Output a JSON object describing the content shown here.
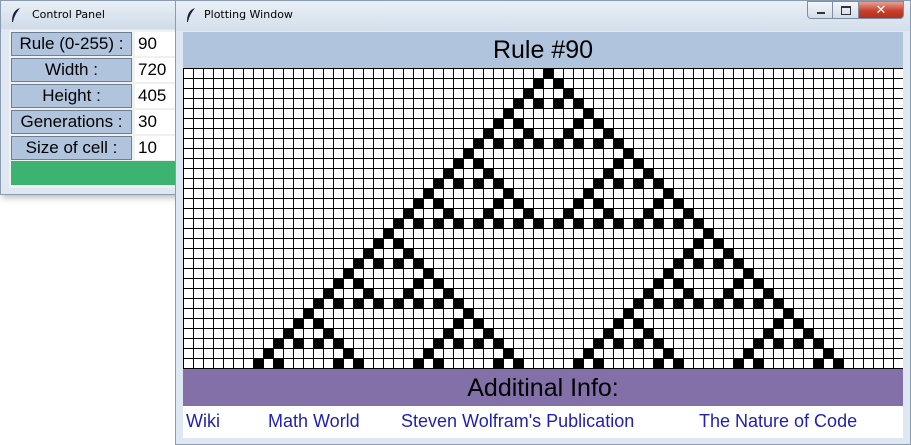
{
  "control_panel": {
    "title": "Control Panel",
    "rows": [
      {
        "label": "Rule (0-255) :",
        "value": "90"
      },
      {
        "label": "Width :",
        "value": "720"
      },
      {
        "label": "Height :",
        "value": "405"
      },
      {
        "label": "Generations :",
        "value": "30"
      },
      {
        "label": "Size of cell :",
        "value": "10"
      }
    ],
    "button_color": "#3cb371"
  },
  "plot_window": {
    "title": "Plotting Window",
    "close_glyph": "✕",
    "header": "Rule #90",
    "info_label": "Additinal Info:",
    "links": [
      "Wiki",
      "Math World",
      "Steven Wolfram's Publication",
      "The Nature of Code"
    ],
    "colors": {
      "header_bg": "#b0c4de",
      "info_bg": "#8470a8",
      "link": "#1f1fb5",
      "cell_on": "#000000"
    }
  },
  "automaton": {
    "rule": 90,
    "generations": 30,
    "columns": 72,
    "cell_size": 10
  }
}
